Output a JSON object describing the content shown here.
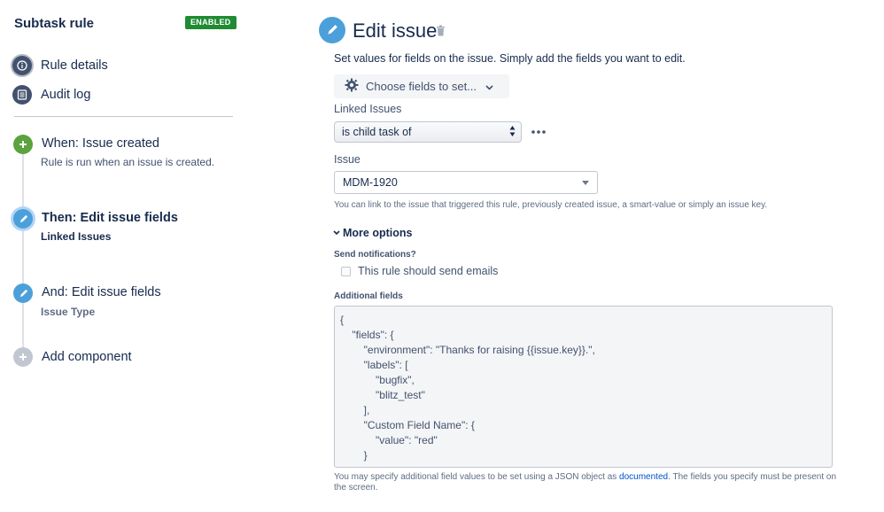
{
  "sidebar": {
    "rule_title": "Subtask rule",
    "status_badge": "ENABLED",
    "nav": [
      {
        "label": "Rule details",
        "icon": "info-icon"
      },
      {
        "label": "Audit log",
        "icon": "list-icon"
      }
    ],
    "steps": [
      {
        "title": "When: Issue created",
        "subtitle": "Rule is run when an issue is created.",
        "icon": "plus-icon",
        "color": "#5aa33e"
      },
      {
        "title": "Then: Edit issue fields",
        "subtitle": "Linked Issues",
        "icon": "pencil-icon",
        "color": "#4ca0d9"
      },
      {
        "title": "And: Edit issue fields",
        "subtitle": "Issue Type",
        "icon": "pencil-icon",
        "color": "#4ca0d9"
      },
      {
        "title": "Add component",
        "icon": "plus-icon",
        "color": "#c1c7d0"
      }
    ]
  },
  "main": {
    "title": "Edit issue",
    "description": "Set values for fields on the issue. Simply add the fields you want to edit.",
    "choose_fields_label": "Choose fields to set...",
    "linked_issues": {
      "label": "Linked Issues",
      "selected": "is child task of"
    },
    "issue": {
      "label": "Issue",
      "value": "MDM-1920",
      "help": "You can link to the issue that triggered this rule, previously created issue, a smart-value or simply an issue key."
    },
    "more_options_label": "More options",
    "send_notifications": {
      "label": "Send notifications?",
      "checkbox_label": "This rule should send emails",
      "checked": false
    },
    "additional_fields": {
      "label": "Additional fields",
      "json_text": "{\n    \"fields\": {\n        \"environment\": \"Thanks for raising {{issue.key}}.\",\n        \"labels\": [\n            \"bugfix\",\n            \"blitz_test\"\n        ],\n        \"Custom Field Name\": {\n            \"value\": \"red\"\n        }"
    },
    "footer": {
      "text_before": "You may specify additional field values to be set using a JSON object as ",
      "link": "documented",
      "text_after": ". The fields you specify must be present on the screen."
    }
  },
  "colors": {
    "accent_blue": "#4ca0d9",
    "trigger_green": "#5aa33e",
    "enabled_badge": "#1f8b33",
    "link": "#0052cc"
  }
}
